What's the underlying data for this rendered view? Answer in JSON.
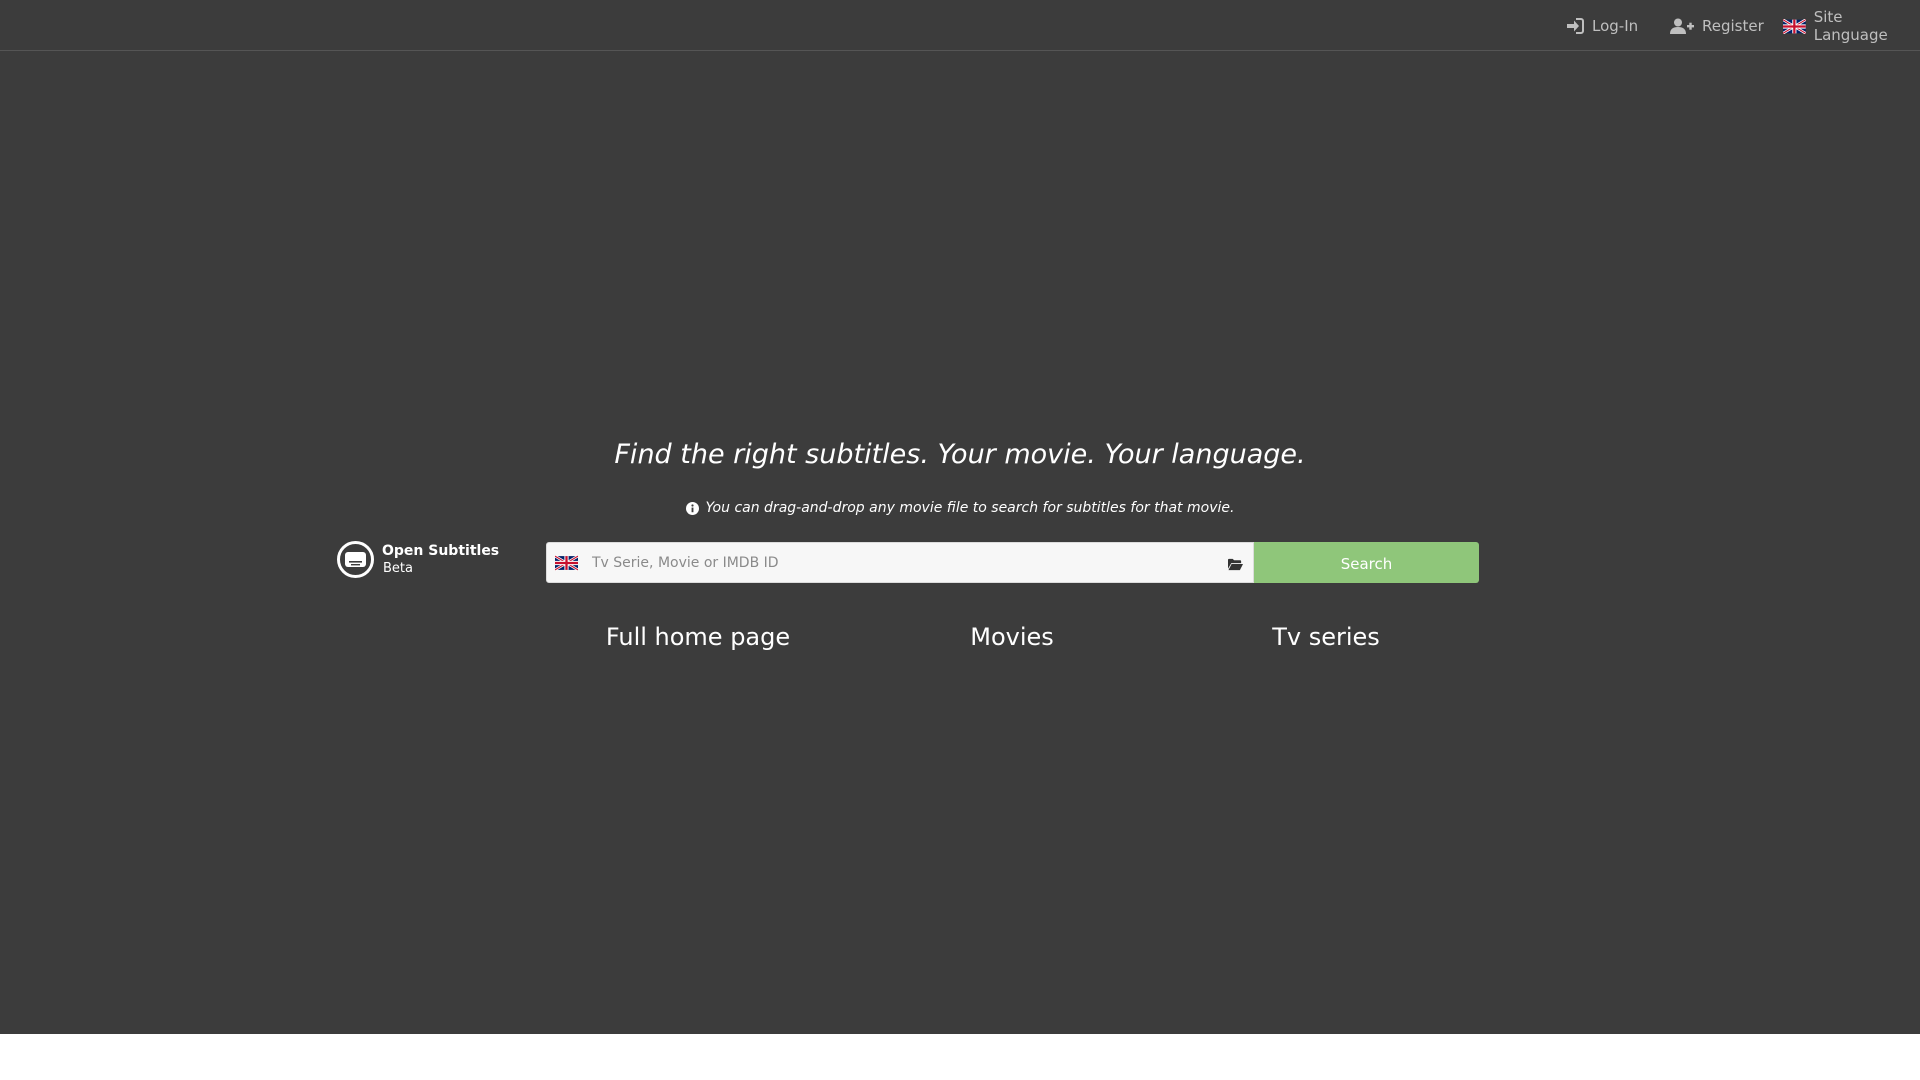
{
  "topbar": {
    "login_label": "Log-In",
    "register_label": "Register",
    "site_language_label": "Site Language"
  },
  "hero": {
    "tagline": "Find the right subtitles. Your movie. Your language.",
    "hint": "You can drag-and-drop any movie file to search for subtitles for that movie."
  },
  "brand": {
    "name": "Open Subtitles",
    "sub": "Beta"
  },
  "search": {
    "placeholder": "Tv Serie, Movie or IMDB ID",
    "value": "",
    "button_label": "Search",
    "language_flag": "uk-flag-icon"
  },
  "links": {
    "full_home": "Full home page",
    "movies": "Movies",
    "tv_series": "Tv series"
  },
  "colors": {
    "background": "#3c3c3c",
    "accent_green": "#8fc67a",
    "nav_text": "#bfbfbf"
  }
}
